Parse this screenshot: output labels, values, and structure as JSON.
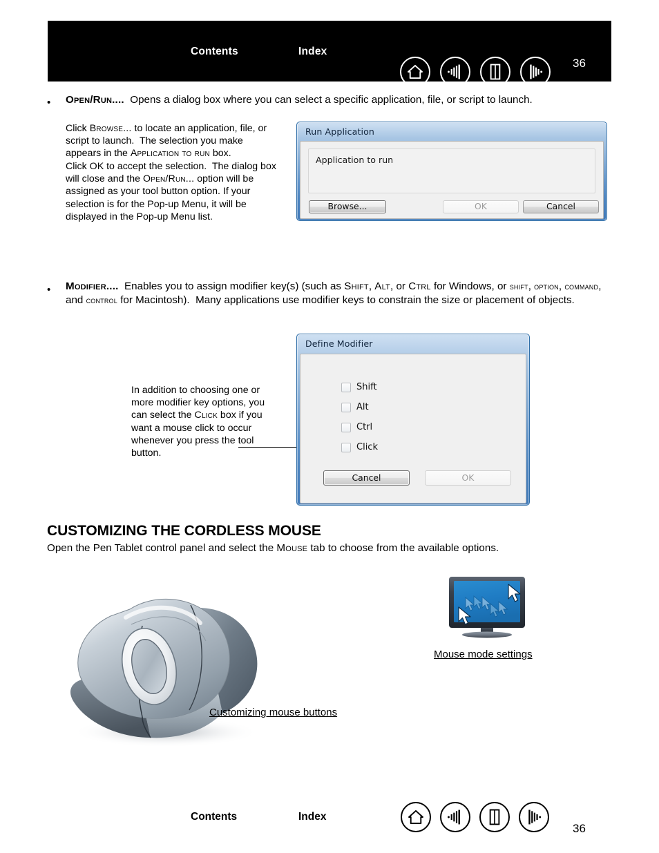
{
  "header": {
    "contents_label": "Contents",
    "index_label": "Index",
    "page_number": "36",
    "icons": [
      {
        "name": "home-icon",
        "label": "Home"
      },
      {
        "name": "previous-view-icon",
        "label": "Previous view"
      },
      {
        "name": "page-view-icon",
        "label": "Page view"
      },
      {
        "name": "next-view-icon",
        "label": "Next view"
      }
    ]
  },
  "footer": {
    "contents_label": "Contents",
    "index_label": "Index",
    "page_number": "36",
    "icons": [
      {
        "name": "home-icon",
        "label": "Home"
      },
      {
        "name": "previous-view-icon",
        "label": "Previous view"
      },
      {
        "name": "page-view-icon",
        "label": "Page view"
      },
      {
        "name": "next-view-icon",
        "label": "Next view"
      }
    ]
  },
  "bullets": {
    "open_run": {
      "bullet": "•",
      "term": "Open/Run....",
      "body": "Opens a dialog box where you can select a specific application, file, or script to launch."
    },
    "modifier": {
      "bullet": "•",
      "term": "Modifier....",
      "body_line1": "Enables you to assign modifier key(s) (such as Shift, Alt, or Ctrl for Windows, or shift,",
      "body_line2": "option, command, and control for Macintosh).  Many applications use modifier keys to constrain the",
      "body_line3": "size or placement of objects."
    }
  },
  "open_run_notes": {
    "para1": "Click Browse... to locate an application, file, or script to launch.  The selection you make appears in the Application to run box.",
    "para2": "Click OK to accept the selection.  The dialog box will close and the Open/Run... option will be assigned as your tool button option.  If your selection is for the Pop-up Menu, it will be displayed in the Pop-up Menu list."
  },
  "run_application_dialog": {
    "title": "Run Application",
    "group_label": "Application to run",
    "browse_label": "Browse...",
    "ok_label": "OK",
    "cancel_label": "Cancel",
    "ok_disabled": true
  },
  "define_modifier_dialog": {
    "title": "Define Modifier",
    "checkboxes": [
      {
        "label": "Shift",
        "checked": false
      },
      {
        "label": "Alt",
        "checked": false
      },
      {
        "label": "Ctrl",
        "checked": false
      },
      {
        "label": "Click",
        "checked": false
      }
    ],
    "cancel_label": "Cancel",
    "ok_label": "OK",
    "ok_disabled": true
  },
  "modifier_annotation": {
    "text": "In addition to choosing one or more modifier key options, you can select the Click box if you want a mouse click to occur whenever you press the tool button."
  },
  "section": {
    "heading": "CUSTOMIZING THE CORDLESS MOUSE",
    "intro": "Open the Pen Tablet control panel and select the Mouse tab to choose from the available options."
  },
  "figures": {
    "mouse_caption": "Customizing mouse buttons",
    "monitor_caption": "Mouse mode settings"
  },
  "colors": {
    "header_bg": "#000000",
    "header_text": "#ffffff",
    "dialog_title_gradient_start": "#cfe0f2",
    "dialog_title_gradient_end": "#3f79b9",
    "dialog_body": "#f0f0f0",
    "monitor_screen": "#1f7cc4",
    "mouse_body": "#aab4bc"
  }
}
